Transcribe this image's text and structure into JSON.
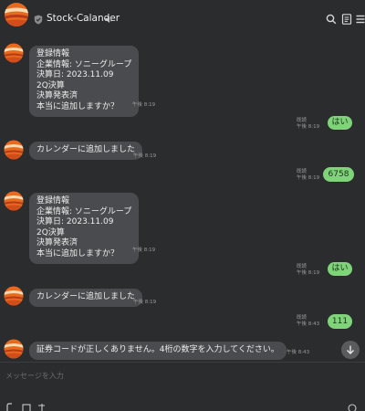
{
  "header": {
    "title": "Stock-Calander",
    "icons": [
      "avatar",
      "shield-icon",
      "speaker-icon",
      "search-icon",
      "notes-icon",
      "menu-icon"
    ]
  },
  "messages": [
    {
      "side": "in",
      "lines": [
        "登録情報",
        "企業情報: ソニーグループ",
        "決算日: 2023.11.09",
        "2Q決算",
        "決算発表済",
        "本当に追加しますか？"
      ],
      "time": "午後 8:19"
    },
    {
      "side": "out",
      "text": "はい",
      "read": "既読",
      "time": "午後 8:19"
    },
    {
      "side": "in",
      "lines": [
        "カレンダーに追加しました"
      ],
      "time": "午後 8:19"
    },
    {
      "side": "out",
      "text": "6758",
      "read": "既読",
      "time": "午後 8:19"
    },
    {
      "side": "in",
      "lines": [
        "登録情報",
        "企業情報: ソニーグループ",
        "決算日: 2023.11.09",
        "2Q決算",
        "決算発表済",
        "本当に追加しますか？"
      ],
      "time": "午後 8:19"
    },
    {
      "side": "out",
      "text": "はい",
      "read": "既読",
      "time": "午後 8:19"
    },
    {
      "side": "in",
      "lines": [
        "カレンダーに追加しました"
      ],
      "time": "午後 8:19"
    },
    {
      "side": "out",
      "text": "111",
      "read": "既読",
      "time": "午後 8:43"
    },
    {
      "side": "in",
      "lines": [
        "証券コードが正しくありません。4桁の数字を入力してください。"
      ],
      "time": "午後 8:43"
    }
  ],
  "composer": {
    "placeholder": "メッセージを入力"
  },
  "colors": {
    "background": "#2b2c2e",
    "incoming_bubble": "#4a4b4e",
    "outgoing_bubble": "#7fd47a"
  }
}
